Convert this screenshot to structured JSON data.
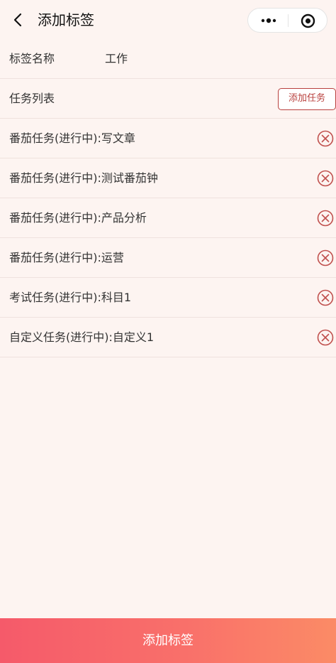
{
  "nav": {
    "title": "添加标签"
  },
  "form": {
    "tag_name_label": "标签名称",
    "tag_name_value": "工作",
    "task_list_label": "任务列表",
    "add_task_label": "添加任务"
  },
  "tasks": [
    {
      "text": "番茄任务(进行中):写文章"
    },
    {
      "text": "番茄任务(进行中):测试番茄钟"
    },
    {
      "text": "番茄任务(进行中):产品分析"
    },
    {
      "text": "番茄任务(进行中):运营"
    },
    {
      "text": "考试任务(进行中):科目1"
    },
    {
      "text": "自定义任务(进行中):自定义1"
    }
  ],
  "footer": {
    "submit_label": "添加标签"
  },
  "colors": {
    "accent": "#b9413e",
    "background": "#fdf4f1",
    "delete_icon": "#c0504d",
    "button_gradient_start": "#f55a6a",
    "button_gradient_end": "#fb8b66"
  },
  "icons": {
    "back": "chevron-left-icon",
    "more": "more-dots-icon",
    "close": "target-icon",
    "delete": "close-circle-icon"
  }
}
